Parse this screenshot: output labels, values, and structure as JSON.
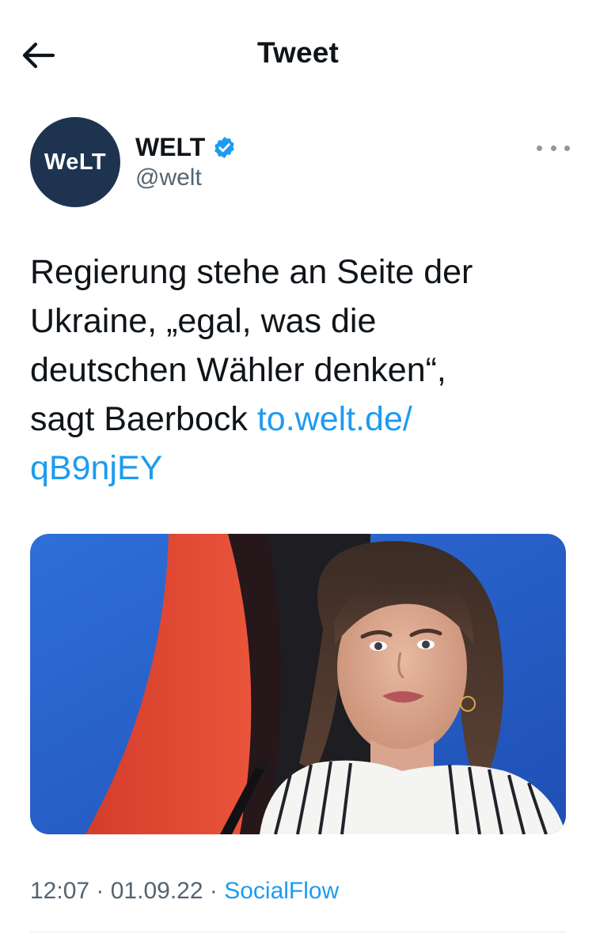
{
  "header": {
    "title": "Tweet",
    "back_icon": "arrow-left-icon"
  },
  "author": {
    "avatar_logo": "WeLT",
    "name": "WELT",
    "handle": "@welt",
    "verified_icon": "verified-badge-icon",
    "more_icon": "more-options-icon"
  },
  "tweet": {
    "text_line_1": "Regierung stehe an Seite der",
    "text_line_2": "Ukraine, „egal, was die",
    "text_line_3": "deutschen Wähler denken“,",
    "text_line_4": "sagt Baerbock ",
    "link_part_1": "to.welt.de/",
    "link_part_2": "qB9njEY"
  },
  "meta": {
    "time": "12:07",
    "sep1": " · ",
    "date": "01.09.22",
    "sep2": " · ",
    "source": "SocialFlow"
  },
  "colors": {
    "link": "#1d9bf0",
    "avatar_bg": "#1e3350",
    "verified": "#1d9bf0",
    "secondary_text": "#536471"
  }
}
